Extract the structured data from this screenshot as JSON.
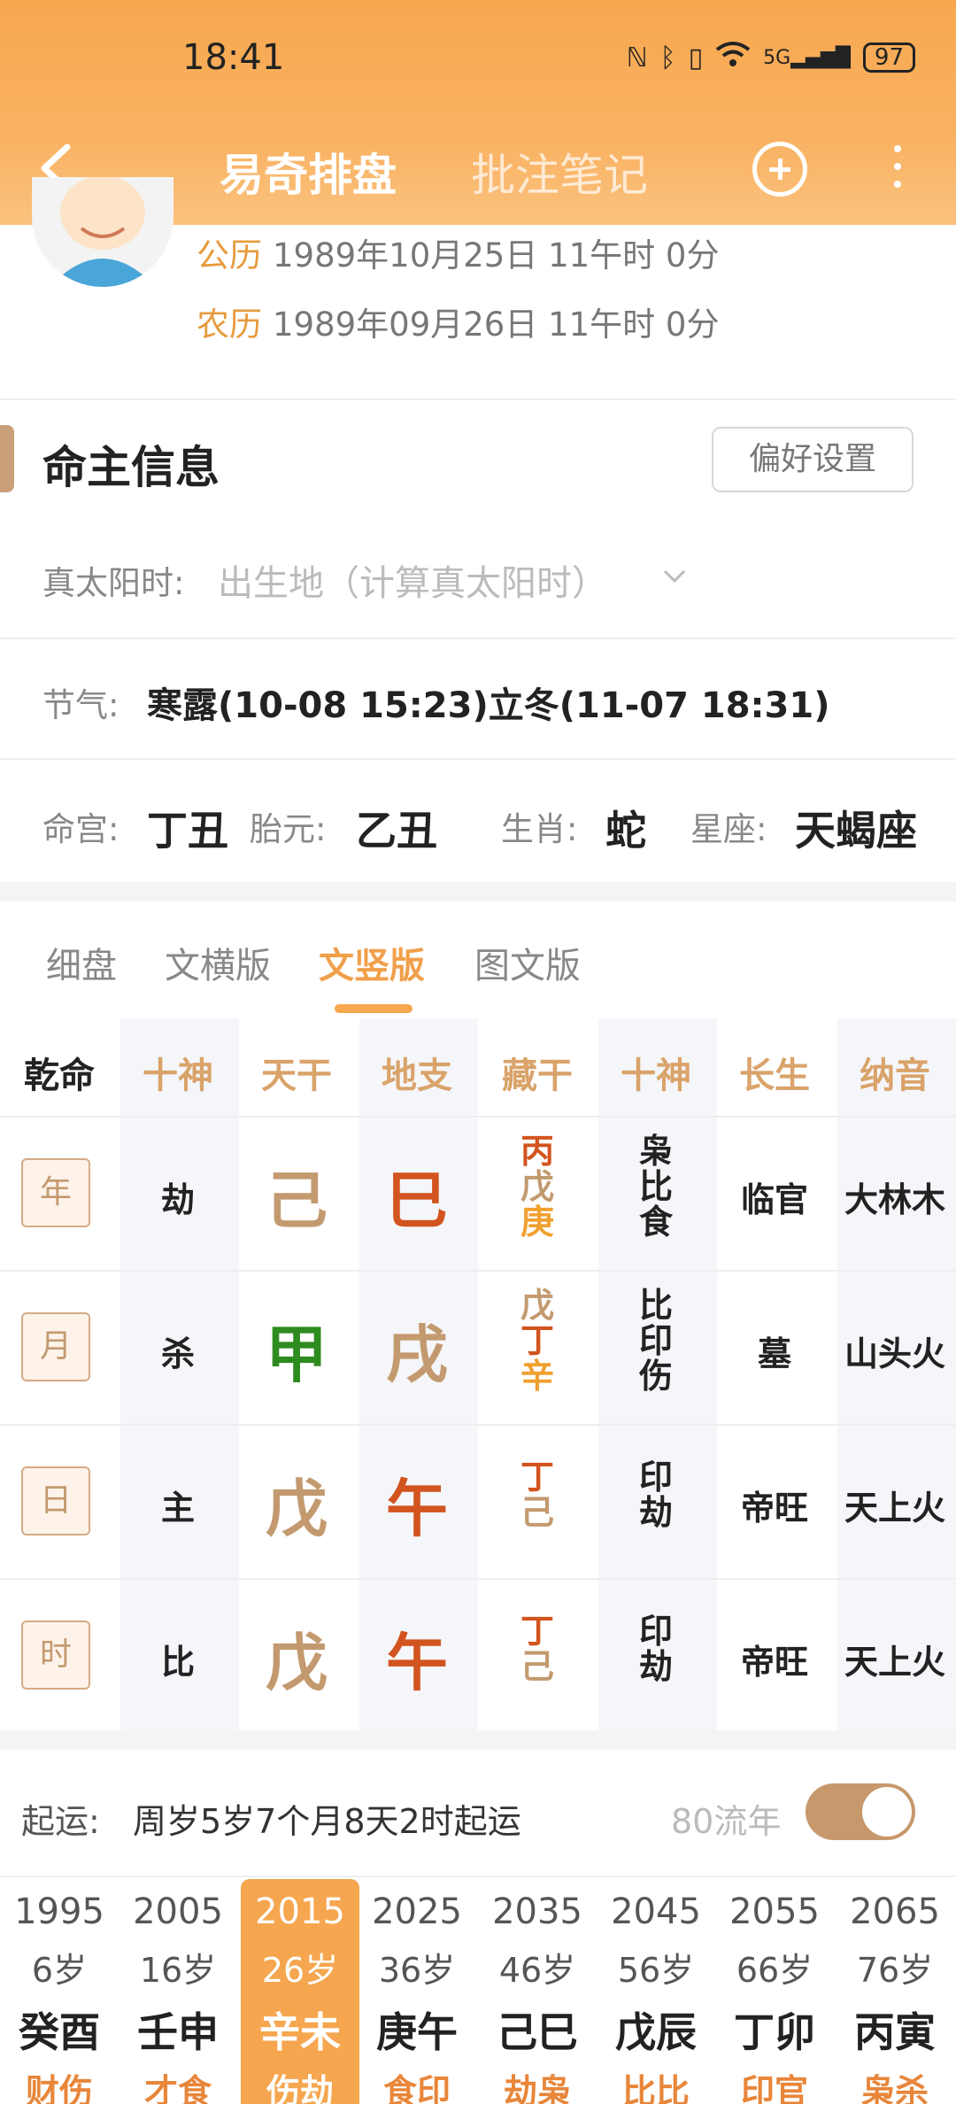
{
  "status": {
    "time": "18:41",
    "battery": "97",
    "network": "5G"
  },
  "nav": {
    "title": "易奇排盘",
    "subtitle": "批注笔记"
  },
  "birth": {
    "solar_label": "公历",
    "solar_value": "1989年10月25日 11午时 0分",
    "lunar_label": "农历",
    "lunar_value": "1989年09月26日 11午时 0分"
  },
  "info": {
    "title": "命主信息",
    "pref_button": "偏好设置",
    "true_solar_label": "真太阳时:",
    "true_solar_placeholder": "出生地（计算真太阳时）",
    "jieqi_label": "节气:",
    "jieqi_value": "寒露(10-08 15:23)立冬(11-07 18:31)",
    "minggong_label": "命宫:",
    "minggong_value": "丁丑",
    "taiyuan_label": "胎元:",
    "taiyuan_value": "乙丑",
    "shengxiao_label": "生肖:",
    "shengxiao_value": "蛇",
    "xingzuo_label": "星座:",
    "xingzuo_value": "天蝎座"
  },
  "tabs": [
    "细盘",
    "文横版",
    "文竖版",
    "图文版"
  ],
  "active_tab": "文竖版",
  "chart": {
    "headers": [
      "乾命",
      "十神",
      "天干",
      "地支",
      "藏干",
      "十神",
      "长生",
      "纳音"
    ],
    "rows": [
      {
        "pillar": "年",
        "shishen": "劫",
        "gan": "己",
        "zhi": "巳",
        "cang": [
          "丙",
          "戊",
          "庚"
        ],
        "ss2": [
          "枭",
          "比",
          "食"
        ],
        "changsheng": "临官",
        "nayin": "大林木"
      },
      {
        "pillar": "月",
        "shishen": "杀",
        "gan": "甲",
        "zhi": "戌",
        "cang": [
          "戊",
          "丁",
          "辛"
        ],
        "ss2": [
          "比",
          "印",
          "伤"
        ],
        "changsheng": "墓",
        "nayin": "山头火"
      },
      {
        "pillar": "日",
        "shishen": "主",
        "gan": "戊",
        "zhi": "午",
        "cang": [
          "丁",
          "己"
        ],
        "ss2": [
          "印",
          "劫"
        ],
        "changsheng": "帝旺",
        "nayin": "天上火"
      },
      {
        "pillar": "时",
        "shishen": "比",
        "gan": "戊",
        "zhi": "午",
        "cang": [
          "丁",
          "己"
        ],
        "ss2": [
          "印",
          "劫"
        ],
        "changsheng": "帝旺",
        "nayin": "天上火"
      }
    ]
  },
  "colors": {
    "wood": "#2e8b1f",
    "fire": "#d2541f",
    "earth": "#c39a6f",
    "metal": "#f0a030",
    "accent": "#f5a64f"
  },
  "luck": {
    "label": "起运:",
    "value": "周岁5岁7个月8天2时起运",
    "liunian": "80流年",
    "toggle_on": true,
    "columns": [
      {
        "year": "1995",
        "age": "6岁",
        "gz": "癸酉",
        "ss": "财伤"
      },
      {
        "year": "2005",
        "age": "16岁",
        "gz": "壬申",
        "ss": "才食"
      },
      {
        "year": "2015",
        "age": "26岁",
        "gz": "辛未",
        "ss": "伤劫"
      },
      {
        "year": "2025",
        "age": "36岁",
        "gz": "庚午",
        "ss": "食印"
      },
      {
        "year": "2035",
        "age": "46岁",
        "gz": "己巳",
        "ss": "劫枭"
      },
      {
        "year": "2045",
        "age": "56岁",
        "gz": "戊辰",
        "ss": "比比"
      },
      {
        "year": "2055",
        "age": "66岁",
        "gz": "丁卯",
        "ss": "印官"
      },
      {
        "year": "2065",
        "age": "76岁",
        "gz": "丙寅",
        "ss": "枭杀"
      }
    ],
    "active_index": 2
  }
}
